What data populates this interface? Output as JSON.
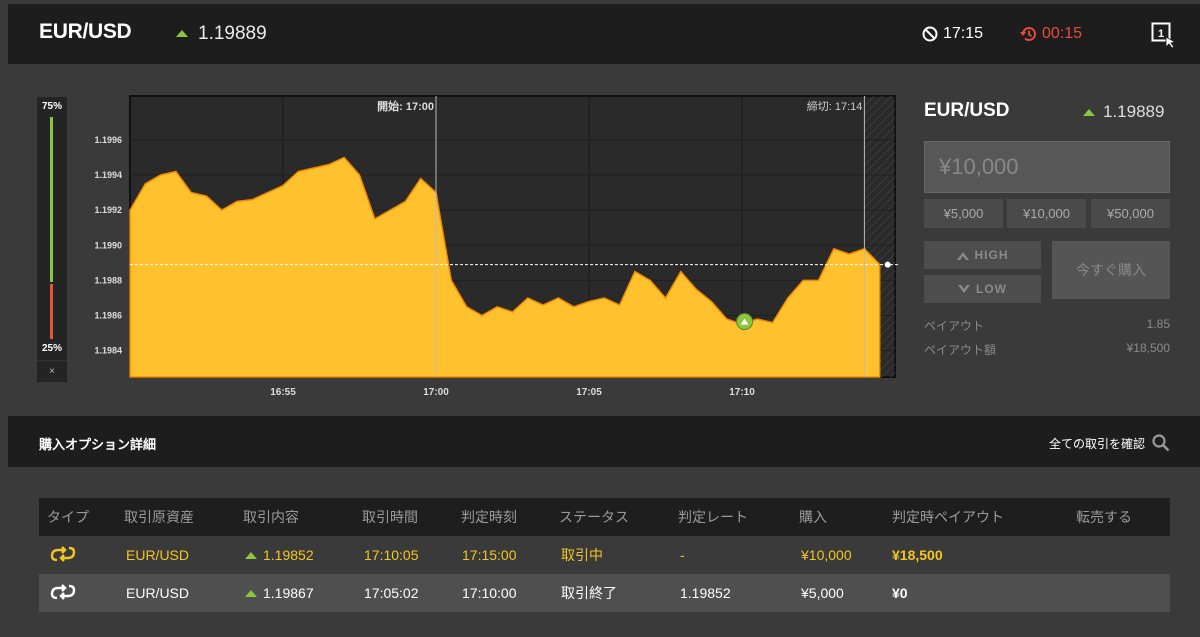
{
  "header": {
    "pair": "EUR/USD",
    "rate": "1.19889",
    "close_time": "17:15",
    "countdown": "00:15"
  },
  "rate_gauge": {
    "top_label": "75%",
    "bottom_label": "25%",
    "close": "×",
    "high_fraction": 0.75,
    "low_fraction": 0.25
  },
  "chart_data": {
    "type": "area",
    "y_ticks": [
      "1.1996",
      "1.1994",
      "1.1992",
      "1.1990",
      "1.1988",
      "1.1986",
      "1.1984"
    ],
    "x_ticks": [
      "16:55",
      "17:00",
      "17:05",
      "17:10"
    ],
    "start_label": "開始: 17:00",
    "end_label": "締切: 17:14",
    "ylim": [
      1.19825,
      1.19985
    ],
    "x_range": [
      "16:50",
      "17:15"
    ],
    "current_rate": 1.19889,
    "series": [
      {
        "color": "#ffc12e",
        "x": [
          "16:50:00",
          "16:50:30",
          "16:51:00",
          "16:51:30",
          "16:52:00",
          "16:52:30",
          "16:53:00",
          "16:53:30",
          "16:54:00",
          "16:54:30",
          "16:55:00",
          "16:55:30",
          "16:56:00",
          "16:56:30",
          "16:57:00",
          "16:57:30",
          "16:58:00",
          "16:58:30",
          "16:59:00",
          "16:59:30",
          "17:00:00",
          "17:00:30",
          "17:01:00",
          "17:01:30",
          "17:02:00",
          "17:02:30",
          "17:03:00",
          "17:03:30",
          "17:04:00",
          "17:04:30",
          "17:05:00",
          "17:05:30",
          "17:06:00",
          "17:06:30",
          "17:07:00",
          "17:07:30",
          "17:08:00",
          "17:08:30",
          "17:09:00",
          "17:09:30",
          "17:10:00",
          "17:10:30",
          "17:11:00",
          "17:11:30",
          "17:12:00",
          "17:12:30",
          "17:13:00",
          "17:13:30",
          "17:14:00",
          "17:14:30"
        ],
        "values": [
          1.1992,
          1.19935,
          1.1994,
          1.19942,
          1.1993,
          1.19928,
          1.1992,
          1.19925,
          1.19926,
          1.1993,
          1.19934,
          1.19942,
          1.19944,
          1.19946,
          1.1995,
          1.1994,
          1.19915,
          1.1992,
          1.19925,
          1.19938,
          1.1993,
          1.1988,
          1.19865,
          1.1986,
          1.19865,
          1.19862,
          1.1987,
          1.19866,
          1.1987,
          1.19865,
          1.19868,
          1.1987,
          1.19866,
          1.19885,
          1.1988,
          1.1987,
          1.19885,
          1.19875,
          1.19868,
          1.19858,
          1.19855,
          1.19858,
          1.19856,
          1.1987,
          1.1988,
          1.1988,
          1.19898,
          1.19895,
          1.19898,
          1.19889
        ]
      }
    ],
    "markers": [
      {
        "x": "17:10:05",
        "value": 1.19852,
        "color": "#8cc63f"
      }
    ]
  },
  "order_panel": {
    "pair": "EUR/USD",
    "rate": "1.19889",
    "amount_placeholder": "¥10,000",
    "quick_amounts": [
      "¥5,000",
      "¥10,000",
      "¥50,000"
    ],
    "high_label": "HIGH",
    "low_label": "LOW",
    "buy_now_label": "今すぐ購入",
    "payout_label": "ペイアウト",
    "payout_value": "1.85",
    "payout_amount_label": "ペイアウト額",
    "payout_amount_value": "¥18,500"
  },
  "details": {
    "title": "購入オプション詳細",
    "view_all": "全ての取引を確認",
    "columns": [
      "タイプ",
      "取引原資産",
      "取引内容",
      "取引時間",
      "判定時刻",
      "ステータス",
      "判定レート",
      "購入",
      "判定時ペイアウト",
      "転売する"
    ],
    "rows": [
      {
        "asset": "EUR/USD",
        "entry": "1.19852",
        "time": "17:10:05",
        "expiry": "17:15:00",
        "status": "取引中",
        "judge_rate": "-",
        "purchase": "¥10,000",
        "payout": "¥18,500",
        "icon_color": "#f3c622"
      },
      {
        "asset": "EUR/USD",
        "entry": "1.19867",
        "time": "17:05:02",
        "expiry": "17:10:00",
        "status": "取引終了",
        "judge_rate": "1.19852",
        "purchase": "¥5,000",
        "payout": "¥0",
        "icon_color": "#ffffff"
      }
    ]
  }
}
